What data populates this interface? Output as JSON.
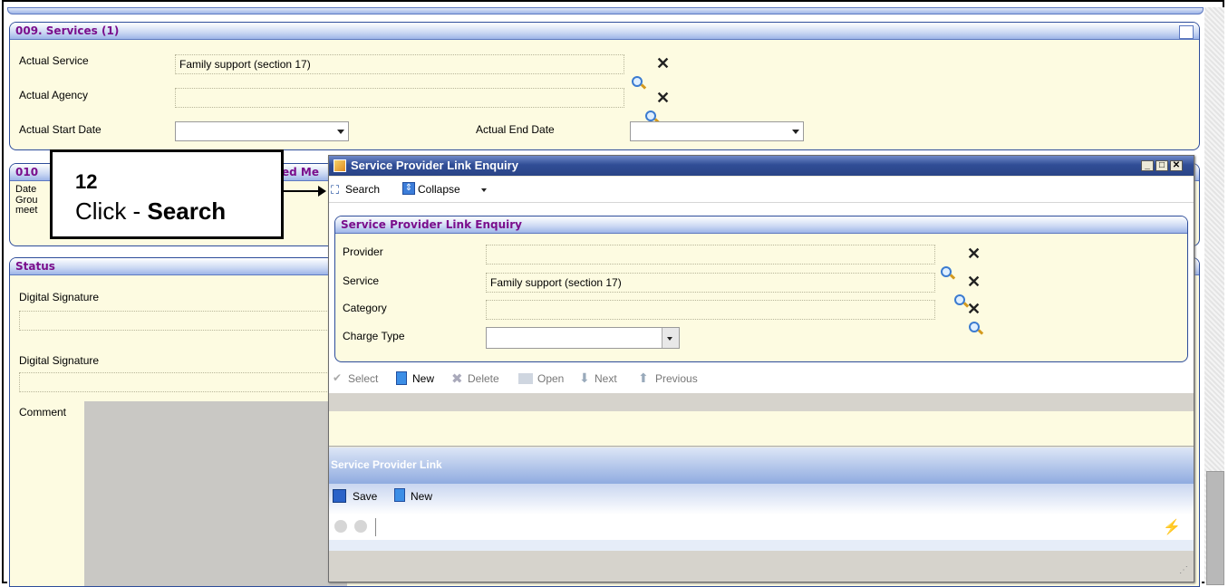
{
  "services_panel": {
    "title": "009. Services (1)",
    "actual_service_label": "Actual Service",
    "actual_service_value": "Family  support (section 17)",
    "actual_agency_label": "Actual Agency",
    "actual_agency_value": "",
    "actual_start_date_label": "Actual Start Date",
    "actual_end_date_label": "Actual End Date"
  },
  "meeting_panel": {
    "title_prefix": "010",
    "title_suffix": "ed Me",
    "date_label": "Date",
    "group_label": "Grou",
    "meet_label": "meet"
  },
  "status_panel": {
    "title": "Status",
    "digital_signature_1_label": "Digital Signature",
    "digital_signature_2_label": "Digital Signature",
    "comment_label": "Comment"
  },
  "callout": {
    "step_number": "12",
    "text_prefix": "Click - ",
    "text_bold": "Search"
  },
  "dialog": {
    "title": "Service Provider Link Enquiry",
    "toolbar": {
      "search_label": "Search",
      "collapse_label": "Collapse"
    },
    "enquiry_panel": {
      "title": "Service Provider Link Enquiry",
      "provider_label": "Provider",
      "provider_value": "",
      "service_label": "Service",
      "service_value": "Family  support (section 17)",
      "category_label": "Category",
      "category_value": "",
      "charge_type_label": "Charge Type"
    },
    "action_bar": {
      "select_label": "Select",
      "new_label": "New",
      "delete_label": "Delete",
      "open_label": "Open",
      "next_label": "Next",
      "previous_label": "Previous"
    },
    "link_section": {
      "title": "Service Provider Link",
      "save_label": "Save",
      "new_label": "New"
    }
  },
  "colors": {
    "panel_bg": "#fdfbe1",
    "panel_title": "#7a0e8c",
    "dialog_title_bg": "#2a4486"
  }
}
